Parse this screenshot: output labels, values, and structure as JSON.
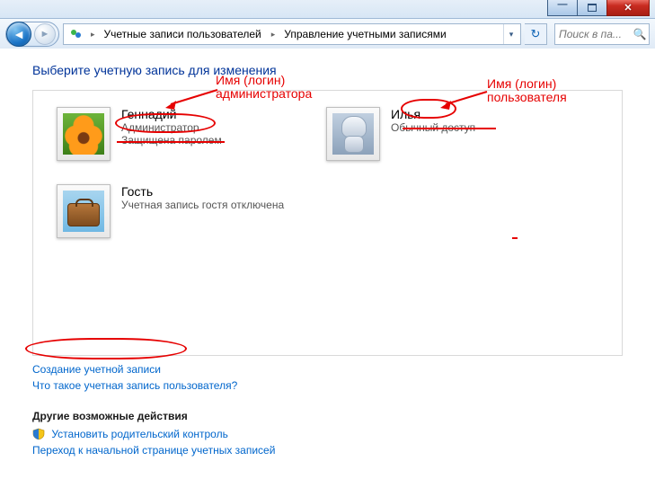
{
  "window": {
    "minimize_tip": "Свернуть",
    "maximize_tip": "Развернуть",
    "close_tip": "Закрыть"
  },
  "nav": {
    "back_tip": "Назад",
    "forward_tip": "Вперёд",
    "refresh_tip": "Обновить"
  },
  "breadcrumb": {
    "seg1": "Учетные записи пользователей",
    "seg2": "Управление учетными записями"
  },
  "search": {
    "placeholder": "Поиск в па..."
  },
  "heading": "Выберите учетную запись для изменения",
  "accounts": [
    {
      "name": "Геннадий",
      "role": "Администратор",
      "pw": "Защищена паролем",
      "pic": "flower"
    },
    {
      "name": "Илья",
      "role": "Обычный доступ",
      "pw": "",
      "pic": "robot"
    },
    {
      "name": "Гость",
      "role": "Учетная запись гостя отключена",
      "pw": "",
      "pic": "suitcase"
    }
  ],
  "links": {
    "create": "Создание учетной записи",
    "whatis": "Что такое учетная запись пользователя?"
  },
  "other": {
    "heading": "Другие возможные действия",
    "parental": "Установить родительский контроль",
    "gohome": "Переход к начальной странице учетных записей"
  },
  "annotations": {
    "admin_login": "Имя (логин)\nадминистратора",
    "user_login": "Имя (логин)\nпользователя"
  }
}
